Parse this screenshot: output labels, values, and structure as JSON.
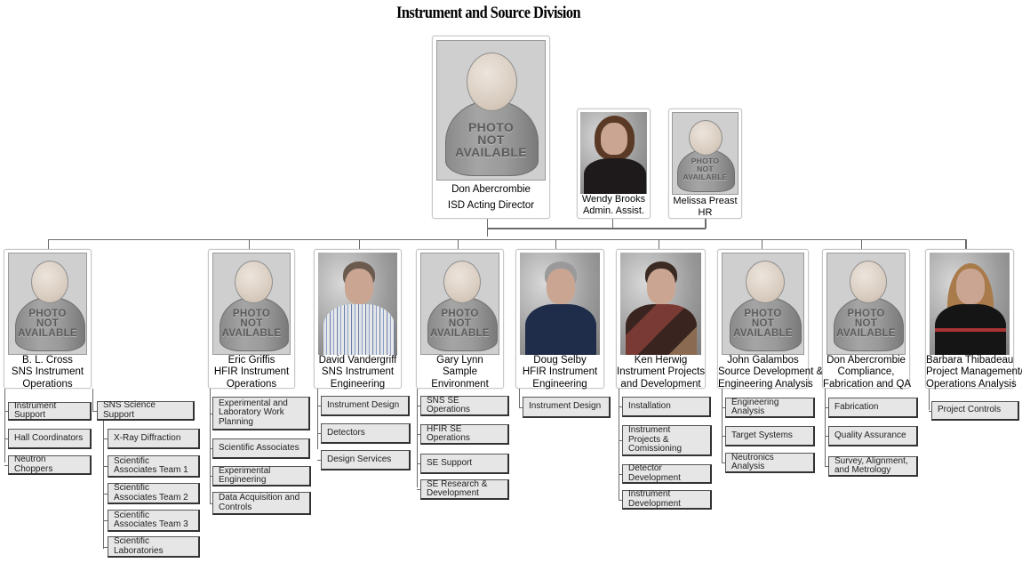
{
  "title": "Instrument and Source Division",
  "director": {
    "name": "Don Abercrombie",
    "role": "ISD Acting Director",
    "photo": "photo-not-available"
  },
  "staff": [
    {
      "name": "Wendy Brooks",
      "role": "Admin. Assist.",
      "photo": "portrait"
    },
    {
      "name": "Melissa Preast",
      "role": "HR",
      "photo": "photo-not-available"
    }
  ],
  "placeholder_text": [
    "PHOTO",
    "NOT",
    "AVAILABLE"
  ],
  "groups": [
    {
      "name": "B. L. Cross",
      "role_lines": [
        "SNS Instrument",
        "Operations"
      ],
      "photo": "photo-not-available",
      "units": [
        "Instrument Support",
        "Hall Coordinators",
        "Neutron Choppers"
      ],
      "subgroup": {
        "name": "SNS Science Support",
        "units": [
          "X-Ray Diffraction",
          "Scientific Associates Team 1",
          "Scientific Associates Team 2",
          "Scientific Associates Team 3",
          "Scientific Laboratories"
        ]
      }
    },
    {
      "name": "Eric Griffis",
      "role_lines": [
        "HFIR Instrument",
        "Operations"
      ],
      "photo": "photo-not-available",
      "units": [
        "Experimental and Laboratory Work Planning",
        "Scientific Associates",
        "Experimental Engineering",
        "Data Acquisition and Controls"
      ]
    },
    {
      "name": "David Vandergriff",
      "role_lines": [
        "SNS Instrument",
        "Engineering"
      ],
      "photo": "portrait",
      "units": [
        "Instrument Design",
        "Detectors",
        "Design Services"
      ]
    },
    {
      "name": "Gary Lynn",
      "role_lines": [
        "Sample",
        "Environment"
      ],
      "photo": "photo-not-available",
      "units": [
        "SNS SE Operations",
        "HFIR SE Operations",
        "SE Support",
        "SE Research & Development"
      ]
    },
    {
      "name": "Doug Selby",
      "role_lines": [
        "HFIR Instrument",
        "Engineering"
      ],
      "photo": "portrait",
      "units": [
        "Instrument Design"
      ]
    },
    {
      "name": "Ken Herwig",
      "role_lines": [
        "Instrument Projects",
        "and Development"
      ],
      "photo": "portrait",
      "units": [
        "Installation",
        "Instrument Projects & Comissioning",
        "Detector Development",
        "Instrument Development"
      ]
    },
    {
      "name": "John Galambos",
      "role_lines": [
        "Source Development &",
        "Engineering Analysis"
      ],
      "photo": "photo-not-available",
      "units": [
        "Engineering Analysis",
        "Target Systems",
        "Neutronics Analysis"
      ]
    },
    {
      "name": "Don Abercrombie",
      "role_lines": [
        "Compliance,",
        "Fabrication and QA"
      ],
      "photo": "photo-not-available",
      "units": [
        "Fabrication",
        "Quality Assurance",
        "Survey, Alignment, and Metrology"
      ]
    },
    {
      "name": "Barbara Thibadeau",
      "role_lines": [
        "Project Management/",
        "Operations Analysis"
      ],
      "photo": "portrait",
      "units": [
        "Project Controls"
      ]
    }
  ]
}
